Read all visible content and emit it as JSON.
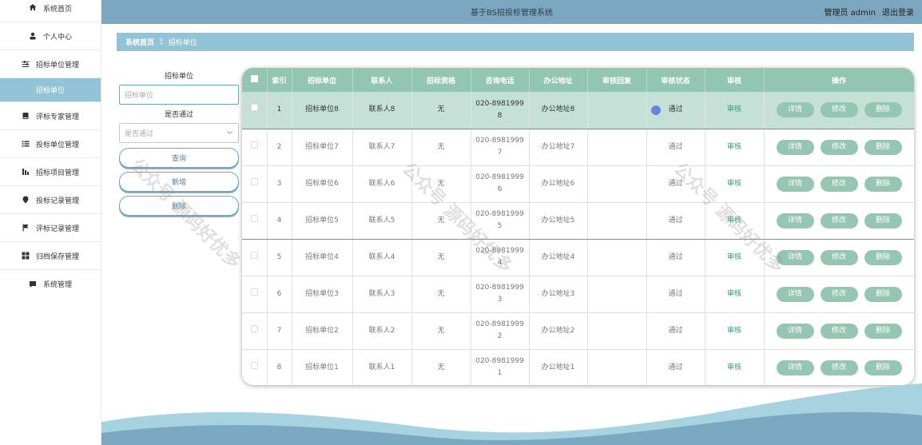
{
  "header": {
    "title": "基于BS招投标管理系统",
    "user": "管理员 admin",
    "logout": "退出登录"
  },
  "sidebar": {
    "items": [
      {
        "label": "系统首页",
        "icon": "home-icon"
      },
      {
        "label": "个人中心",
        "icon": "person-icon"
      },
      {
        "label": "招标单位管理",
        "icon": "sliders-icon"
      },
      {
        "label": "招标单位",
        "icon": ""
      },
      {
        "label": "评标专家管理",
        "icon": "book-icon"
      },
      {
        "label": "投标单位管理",
        "icon": "list-icon"
      },
      {
        "label": "招标项目管理",
        "icon": "chart-icon"
      },
      {
        "label": "投标记录管理",
        "icon": "pin-icon"
      },
      {
        "label": "评标记录管理",
        "icon": "flag-icon"
      },
      {
        "label": "归档保存管理",
        "icon": "grid-icon"
      },
      {
        "label": "系统管理",
        "icon": "chat-icon"
      }
    ]
  },
  "breadcrumb": {
    "home": "系统首页",
    "separator": "Ξ",
    "current": "招标单位"
  },
  "search": {
    "unit_label": "招标单位",
    "unit_placeholder": "招标单位",
    "pass_label": "是否通过",
    "pass_placeholder": "是否通过",
    "query_label": "查询",
    "add_label": "新增",
    "delete_label": "删除"
  },
  "table": {
    "headers": [
      "索引",
      "招标单位",
      "联系人",
      "招标资格",
      "咨询电话",
      "办公地址",
      "审核回复",
      "审核状态",
      "审核",
      "操作"
    ],
    "rows": [
      {
        "index": "1",
        "unit": "招标单位8",
        "contact": "联系人8",
        "qual": "无",
        "phone_a": "020-8981999",
        "phone_b": "8",
        "address": "办公地址8",
        "reply": "",
        "status": "通过",
        "audit": "审核"
      },
      {
        "index": "2",
        "unit": "招标单位7",
        "contact": "联系人7",
        "qual": "无",
        "phone_a": "020-8981999",
        "phone_b": "7",
        "address": "办公地址7",
        "reply": "",
        "status": "通过",
        "audit": "审核"
      },
      {
        "index": "3",
        "unit": "招标单位6",
        "contact": "联系人6",
        "qual": "无",
        "phone_a": "020-8981999",
        "phone_b": "6",
        "address": "办公地址6",
        "reply": "",
        "status": "通过",
        "audit": "审核"
      },
      {
        "index": "4",
        "unit": "招标单位5",
        "contact": "联系人5",
        "qual": "无",
        "phone_a": "020-8981999",
        "phone_b": "5",
        "address": "办公地址5",
        "reply": "",
        "status": "通过",
        "audit": "审核"
      },
      {
        "index": "5",
        "unit": "招标单位4",
        "contact": "联系人4",
        "qual": "无",
        "phone_a": "020-8981999",
        "phone_b": "4",
        "address": "办公地址4",
        "reply": "",
        "status": "通过",
        "audit": "审核"
      },
      {
        "index": "6",
        "unit": "招标单位3",
        "contact": "联系人3",
        "qual": "无",
        "phone_a": "020-8981999",
        "phone_b": "3",
        "address": "办公地址3",
        "reply": "",
        "status": "通过",
        "audit": "审核"
      },
      {
        "index": "7",
        "unit": "招标单位2",
        "contact": "联系人2",
        "qual": "无",
        "phone_a": "020-8981999",
        "phone_b": "2",
        "address": "办公地址2",
        "reply": "",
        "status": "通过",
        "audit": "审核"
      },
      {
        "index": "8",
        "unit": "招标单位1",
        "contact": "联系人1",
        "qual": "无",
        "phone_a": "020-8981999",
        "phone_b": "1",
        "address": "办公地址1",
        "reply": "",
        "status": "通过",
        "audit": "审核"
      }
    ],
    "ops": {
      "detail": "详情",
      "edit": "修改",
      "delete": "删除"
    }
  },
  "watermark": "公众号 源码好优多",
  "colors": {
    "header": "#7ba7c0",
    "accent": "#93c3d6",
    "table_header": "#93c6b2",
    "button": "#94c6b3"
  }
}
